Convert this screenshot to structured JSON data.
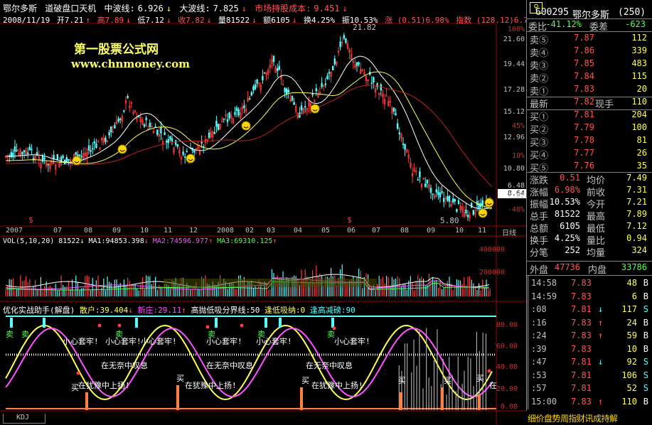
{
  "header": {
    "stock_name": "鄂尔多斯",
    "indicator_name": "道破盘口天机",
    "mid_wave_label": "中波线:",
    "mid_wave_value": "6.926",
    "big_wave_label": "大波线:",
    "big_wave_value": "7.825",
    "cost_label": "市场持股成本:",
    "cost_value": "9.451"
  },
  "info_line": {
    "date": "2008/11/19",
    "open": "开7.21",
    "high": "高7.89",
    "low": "低7.12",
    "close": "收7.82",
    "volume": "量81522",
    "amount": "额6105",
    "turnover": "换4.25%",
    "amplitude": "振10.53%",
    "change": "涨 (0.51)6.98%",
    "index": "指数 (128.12)6.78%"
  },
  "watermark": {
    "line1": "第一股票公式网",
    "line2": "www.chnmoney.com"
  },
  "price_axis": [
    "100%",
    "21.60",
    "19.44",
    "17.28",
    "15.12",
    "45%",
    "12.96",
    "10%",
    "10.80",
    "8.64",
    "7.82",
    "6.48",
    "-40%"
  ],
  "price_marks": {
    "high": "21.82",
    "low": "5.80"
  },
  "time_axis": [
    "2007",
    "07",
    "08",
    "09",
    "10",
    "11",
    "12",
    "2008",
    "02",
    "03",
    "04",
    "05",
    "06",
    "07",
    "08",
    "09",
    "10",
    "11",
    "日线"
  ],
  "volume": {
    "legend_prefix": "VOL(5,10,20)",
    "legend_value": "81522",
    "ma1": "MA1:94853.398",
    "ma2": "MA2:74596.977",
    "ma3": "MA3:69310.125",
    "axis": [
      "400000",
      "200000"
    ]
  },
  "indicator": {
    "title": "优化实战助手(解盘)",
    "retail": "散户:39.404",
    "new_dealer": "新庄:29.11",
    "threshold": "高抛低吸分界线:50",
    "low_buy": "逢低吸纳:0",
    "high_sell": "逢高减磅:90",
    "axis": [
      "80.00",
      "60.00",
      "40.00",
      "20.00",
      "0.00"
    ],
    "texts": {
      "careful": "小心套牢!",
      "sigh": "在无奈中叹息",
      "raise": "在犹豫中上扬!",
      "sell": "卖",
      "buy": "买",
      "raise_short": "在"
    }
  },
  "kdj_tab": "KDJ",
  "quote": {
    "code": "600295",
    "name": "鄂尔多斯",
    "count": "(250)",
    "weibi_label": "委比",
    "weibi_value": "-41.12%",
    "weicha_label": "委差",
    "weicha_value": "-623",
    "asks": [
      {
        "label": "卖⑤",
        "price": "7.87",
        "vol": "112"
      },
      {
        "label": "卖④",
        "price": "7.86",
        "vol": "339"
      },
      {
        "label": "卖③",
        "price": "7.85",
        "vol": "483"
      },
      {
        "label": "卖②",
        "price": "7.84",
        "vol": "115"
      },
      {
        "label": "卖①",
        "price": "7.83",
        "vol": "20"
      }
    ],
    "latest_label": "最新",
    "latest_value": "7.82",
    "now_hand_label": "现手",
    "now_hand_value": "110",
    "bids": [
      {
        "label": "买①",
        "price": "7.81",
        "vol": "204"
      },
      {
        "label": "买②",
        "price": "7.79",
        "vol": "100"
      },
      {
        "label": "买③",
        "price": "7.78",
        "vol": "81"
      },
      {
        "label": "买④",
        "price": "7.77",
        "vol": "26"
      },
      {
        "label": "买⑤",
        "price": "7.76",
        "vol": "35"
      }
    ],
    "stats": [
      {
        "l1": "涨跌",
        "v1": "0.51",
        "l2": "均价",
        "v2": "7.49",
        "c1": "red",
        "c2": "red"
      },
      {
        "l1": "涨幅",
        "v1": "6.98%",
        "l2": "前收",
        "v2": "7.31",
        "c1": "red",
        "c2": "white"
      },
      {
        "l1": "振幅",
        "v1": "10.53%",
        "l2": "今开",
        "v2": "7.21",
        "c1": "white",
        "c2": "green"
      },
      {
        "l1": "总手",
        "v1": "81522",
        "l2": "最高",
        "v2": "7.89",
        "c1": "white",
        "c2": "red"
      },
      {
        "l1": "总额",
        "v1": "6105",
        "l2": "最低",
        "v2": "7.12",
        "c1": "white",
        "c2": "green"
      },
      {
        "l1": "换手",
        "v1": "4.25%",
        "l2": "量比",
        "v2": "0.94",
        "c1": "white",
        "c2": "white"
      },
      {
        "l1": "分笔",
        "v1": "252",
        "l2": "均量",
        "v2": "324",
        "c1": "white",
        "c2": "white"
      }
    ],
    "outer_label": "外盘",
    "outer_value": "47736",
    "inner_label": "内盘",
    "inner_value": "33786"
  },
  "ticks": [
    {
      "t": "14:58",
      "p": "7.83",
      "a": "",
      "v": "48",
      "s": "B"
    },
    {
      "t": "14:59",
      "p": "7.83",
      "a": "",
      "v": "6",
      "s": "B"
    },
    {
      "t": ":08",
      "p": "7.81",
      "a": "↓",
      "v": "117",
      "s": "S"
    },
    {
      "t": ":16",
      "p": "7.83",
      "a": "↑",
      "v": "24",
      "s": "B"
    },
    {
      "t": ":24",
      "p": "7.83",
      "a": "↑",
      "v": "59",
      "s": "B"
    },
    {
      "t": ":39",
      "p": "7.83",
      "a": "",
      "v": "10",
      "s": "B"
    },
    {
      "t": ":47",
      "p": "7.81",
      "a": "↓",
      "v": "92",
      "s": "S"
    },
    {
      "t": ":53",
      "p": "7.81",
      "a": "",
      "v": "106",
      "s": "S"
    },
    {
      "t": ":57",
      "p": "7.81",
      "a": "",
      "v": "52",
      "s": "S"
    },
    {
      "t": "15:00",
      "p": "7.83",
      "a": "↑",
      "v": "110",
      "s": "B"
    }
  ],
  "bottom_tabs": "细价盘势周指财讯成持解"
}
